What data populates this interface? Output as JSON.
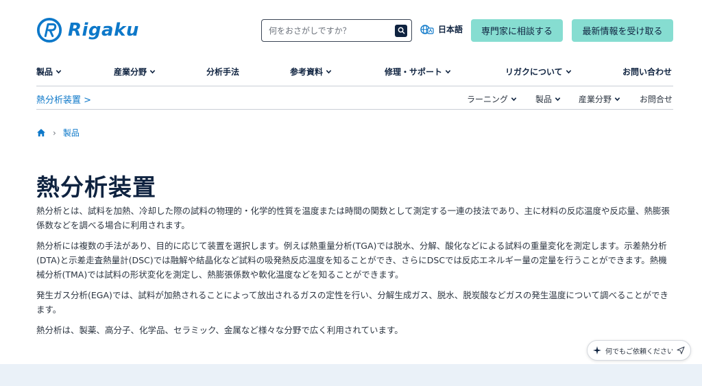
{
  "brand": {
    "name": "Rigaku",
    "color": "#0d78c9"
  },
  "header": {
    "search_placeholder": "何をおさがしですか？",
    "language": "日本語",
    "consult_button": "専門家に相談する",
    "news_button": "最新情報を受け取る"
  },
  "mainnav": {
    "items": [
      {
        "label": "製品"
      },
      {
        "label": "産業分野"
      },
      {
        "label": "分析手法"
      },
      {
        "label": "参考資料"
      },
      {
        "label": "修理・サポート"
      },
      {
        "label": "リガクについて"
      },
      {
        "label": "お問い合わせ"
      }
    ]
  },
  "subnav": {
    "title": "熱分析装置 >",
    "items": [
      {
        "label": "ラーニング"
      },
      {
        "label": "製品"
      },
      {
        "label": "産業分野"
      },
      {
        "label": "お問合せ"
      }
    ]
  },
  "breadcrumb": {
    "current": "製品"
  },
  "page": {
    "title": "熱分析装置",
    "paragraphs": [
      "熱分析とは、試料を加熱、冷却した際の試料の物理的・化学的性質を温度または時間の関数として測定する一連の技法であり、主に材料の反応温度や反応量、熱膨張係数などを調べる場合に利用されます。",
      "熱分析には複数の手法があり、目的に応じて装置を選択します。例えば熱重量分析(TGA)では脱水、分解、酸化などによる試料の重量変化を測定します。示差熱分析(DTA)と示差走査熱量計(DSC)では融解や結晶化など試料の吸発熱反応温度を知ることができ、さらにDSCでは反応エネルギー量の定量を行うことができます。熱機械分析(TMA)では試料の形状変化を測定し、熱膨張係数や軟化温度などを知ることができます。",
      "発生ガス分析(EGA)では、試料が加熱されることによって放出されるガスの定性を行い、分解生成ガス、脱水、脱炭酸などガスの発生温度について調べることができます。",
      "熱分析は、製薬、高分子、化学品、セラミック、金属など様々な分野で広く利用されています。"
    ]
  },
  "chat": {
    "placeholder": "何でもご依頼ください..."
  },
  "colors": {
    "navy": "#0f2340",
    "mint": "#86ddd1",
    "link": "#0d78c9"
  }
}
